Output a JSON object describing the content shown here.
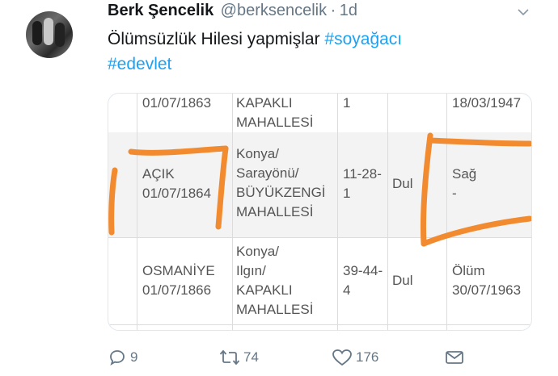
{
  "tweet": {
    "author_name": "Berk Şencelik",
    "handle": "@berksencelik",
    "separator": "·",
    "time": "1d",
    "text": "Ölümsüzlük Hilesi yapmişlar",
    "hashtags": [
      "#soyağacı",
      "#edevlet"
    ]
  },
  "table": {
    "rows": [
      {
        "col1": [
          "01/07/1863"
        ],
        "col2": [
          "KAPAKLI",
          "MAHALLESİ"
        ],
        "col3": [
          "1"
        ],
        "col4": [],
        "col5": [
          "18/03/1947"
        ]
      },
      {
        "col1": [
          "AÇIK",
          "01/07/1864"
        ],
        "col2": [
          "Konya/",
          "Sarayönü/",
          "BÜYÜKZENGİ",
          "MAHALLESİ"
        ],
        "col3": [
          "11-28-",
          "1"
        ],
        "col4": [
          "Dul"
        ],
        "col5": [
          "Sağ",
          "-"
        ]
      },
      {
        "col1": [
          "OSMANİYE",
          "01/07/1866"
        ],
        "col2": [
          "Konya/",
          "Ilgın/",
          "KAPAKLI",
          "MAHALLESİ"
        ],
        "col3": [
          "39-44-",
          "4"
        ],
        "col4": [
          "Dul"
        ],
        "col5": [
          "Ölüm",
          "30/07/1963"
        ]
      }
    ]
  },
  "actions": {
    "replies": "9",
    "retweets": "74",
    "likes": "176"
  },
  "colors": {
    "hashtag": "#1da1f2",
    "highlight": "#f28b30",
    "muted": "#657786"
  },
  "icons": [
    "chevron-down-icon",
    "reply-icon",
    "retweet-icon",
    "like-icon",
    "direct-message-icon"
  ]
}
